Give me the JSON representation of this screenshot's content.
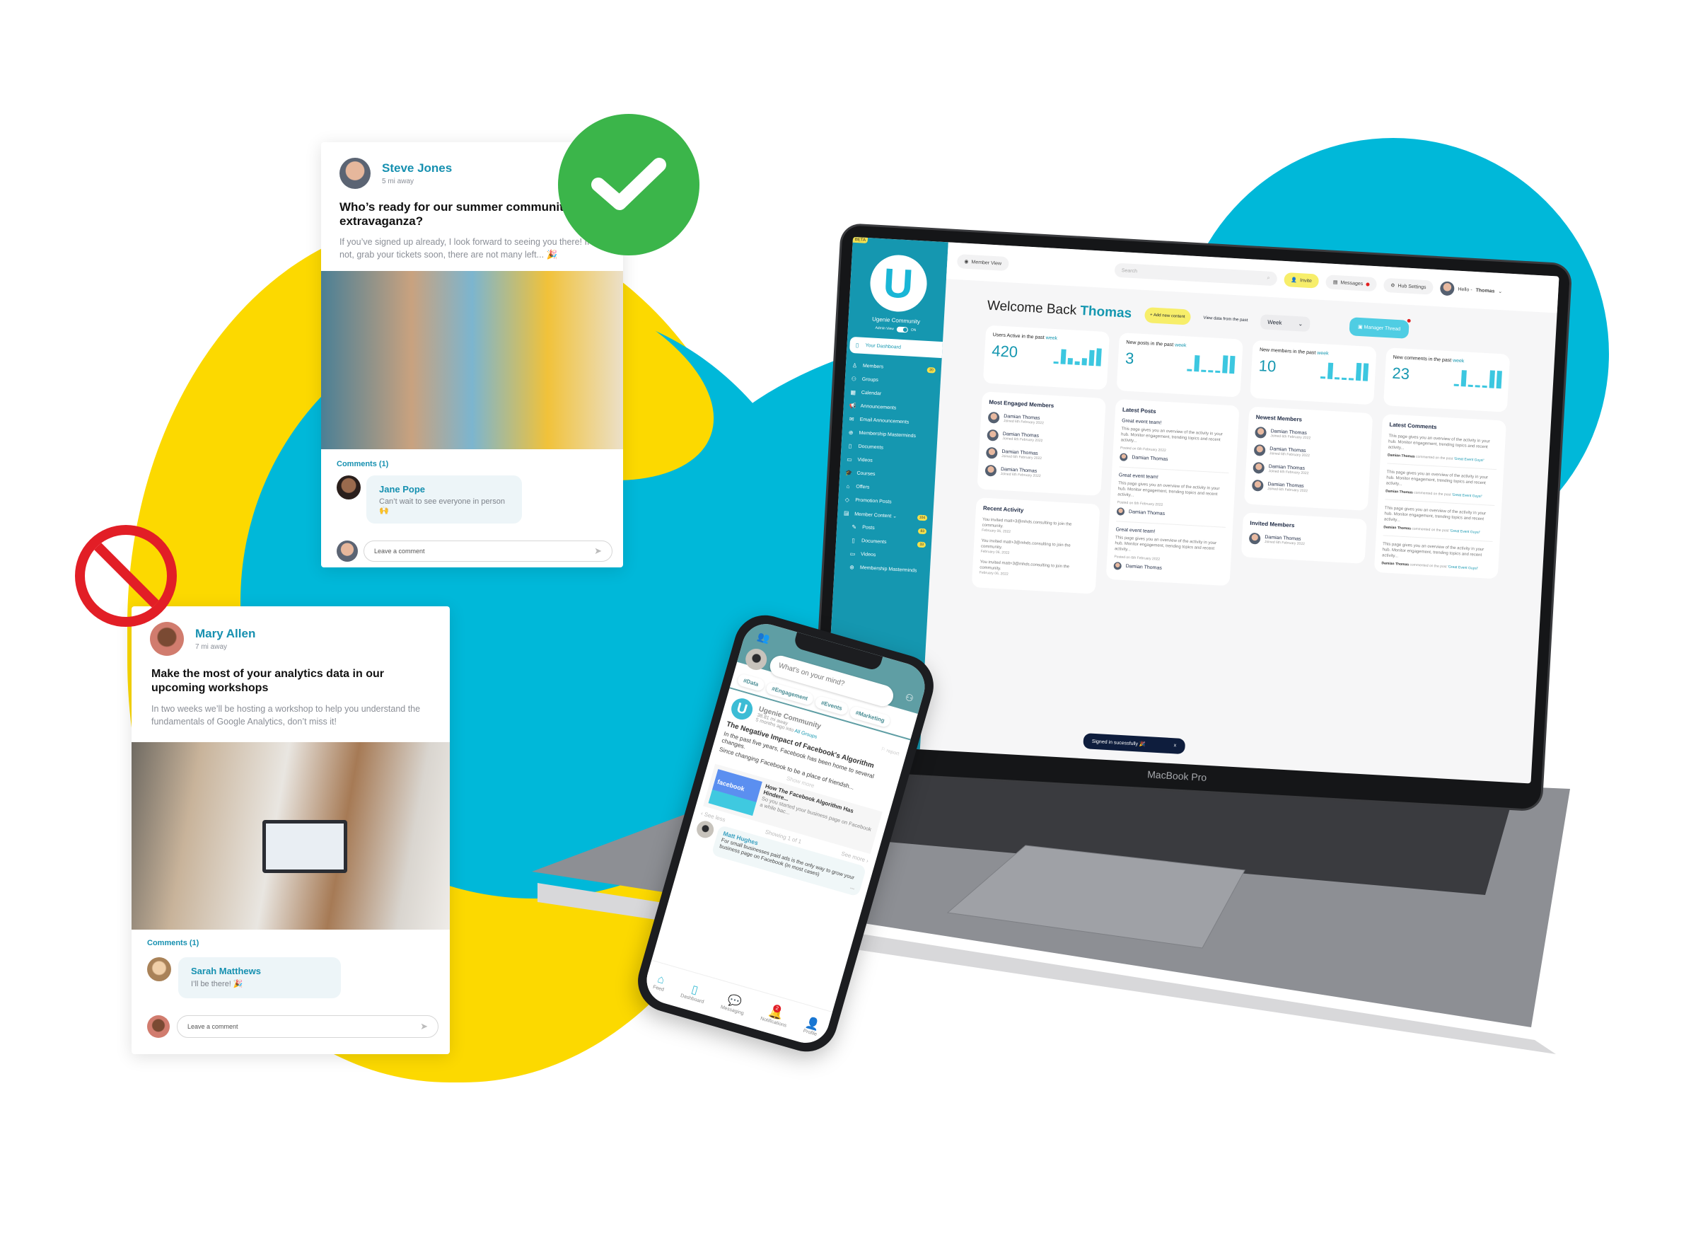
{
  "colors": {
    "yellow": "#fcd900",
    "cyan": "#00b8d9",
    "green": "#3bb54a",
    "red": "#e21e26",
    "teal": "#1597b0"
  },
  "approved_icon": "checkmark-icon",
  "rejected_icon": "prohibited-icon",
  "posts": [
    {
      "author": "Steve Jones",
      "distance": "5 mi away",
      "title": "Who’s ready for our summer community extravaganza?",
      "body": "If you’ve signed up already, I look forward to seeing you there! If not, grab your tickets soon, there are not many left... 🎉",
      "comments_label": "Comments (1)",
      "comment": {
        "author": "Jane Pope",
        "text": "Can’t wait to see everyone in person 🙌"
      },
      "comment_placeholder": "Leave a comment"
    },
    {
      "author": "Mary Allen",
      "distance": "7 mi away",
      "title": "Make the most of your analytics data in our upcoming workshops",
      "body": "In two weeks we’ll be hosting a workshop to help you understand the fundamentals of Google Analytics, don’t miss it!",
      "comments_label": "Comments (1)",
      "comment": {
        "author": "Sarah Matthews",
        "text": "I’ll be there! 🎉"
      },
      "comment_placeholder": "Leave a comment"
    }
  ],
  "laptop": {
    "label": "MacBook Pro"
  },
  "dashboard": {
    "beta": "BETA",
    "brand": "Ugenie Community",
    "admin_view": "Admin View",
    "toggle": "ON",
    "sidebar": [
      {
        "label": "Your Dashboard",
        "icon": "▯",
        "active": true
      },
      {
        "label": "Members",
        "icon": "♙",
        "badge": "20"
      },
      {
        "label": "Groups",
        "icon": "⚇"
      },
      {
        "label": "Calendar",
        "icon": "▦"
      },
      {
        "label": "Announcements",
        "icon": "📢"
      },
      {
        "label": "Email Announcements",
        "icon": "✉"
      },
      {
        "label": "Membership Masterminds",
        "icon": "⊕"
      },
      {
        "label": "Documents",
        "icon": "▯"
      },
      {
        "label": "Videos",
        "icon": "▭"
      },
      {
        "label": "Courses",
        "icon": "🎓"
      },
      {
        "label": "Offers",
        "icon": "⌂"
      },
      {
        "label": "Promotion Posts",
        "icon": "◇"
      },
      {
        "label": "Member Content ⌄",
        "icon": "▤",
        "badge": "104"
      },
      {
        "label": "Posts",
        "icon": "✎",
        "badge": "83",
        "sub": true
      },
      {
        "label": "Documents",
        "icon": "▯",
        "badge": "33",
        "sub": true
      },
      {
        "label": "Videos",
        "icon": "▭",
        "sub": true
      },
      {
        "label": "Membership Masterminds",
        "icon": "⊕",
        "sub": true
      }
    ],
    "topbar": {
      "member_view": "Member View",
      "search_placeholder": "Search",
      "invite": "Invite",
      "messages": "Messages",
      "hub_settings": "Hub Settings",
      "greeting": "Hello -",
      "user": "Thomas"
    },
    "welcome": "Welcome Back",
    "welcome_name": "Thomas",
    "add_content": "+ Add new content",
    "view_data": "View data from the past",
    "period": "Week",
    "manager_thread": "Manager Thread",
    "stats": [
      {
        "label": "Users Active in the past",
        "unit": "week",
        "value": "420",
        "spark": [
          0.1,
          0.8,
          0.35,
          0.2,
          0.4,
          0.85,
          0.95
        ]
      },
      {
        "label": "New posts in the past",
        "unit": "week",
        "value": "3",
        "spark": [
          0.1,
          0.9,
          0.1,
          0.1,
          0.1,
          0.95,
          0.95
        ]
      },
      {
        "label": "New members in the past",
        "unit": "week",
        "value": "10",
        "spark": [
          0.1,
          0.9,
          0.1,
          0.1,
          0.1,
          0.95,
          0.95
        ]
      },
      {
        "label": "New comments in the past",
        "unit": "week",
        "value": "23",
        "spark": [
          0.1,
          0.9,
          0.1,
          0.1,
          0.1,
          0.95,
          0.95
        ]
      }
    ],
    "most_engaged": {
      "title": "Most Engaged Members",
      "items": [
        {
          "name": "Damian Thomas",
          "sub": "Joined 6th February 2022"
        },
        {
          "name": "Damian Thomas",
          "sub": "Joined 6th February 2022"
        },
        {
          "name": "Damian Thomas",
          "sub": "Joined 6th February 2022"
        },
        {
          "name": "Damian Thomas",
          "sub": "Joined 6th February 2022"
        }
      ]
    },
    "recent_activity": {
      "title": "Recent Activity",
      "items": [
        {
          "text": "You invited matt+3@mhds.consulting to join the community.",
          "date": "February 06, 2022"
        },
        {
          "text": "You invited matt+3@mhds.consulting to join the community.",
          "date": "February 06, 2022"
        },
        {
          "text": "You invited matt+3@mhds.consulting to join the community.",
          "date": "February 06, 2022"
        }
      ]
    },
    "latest_posts": {
      "title": "Latest Posts",
      "items": [
        {
          "title": "Great event team!",
          "text": "This page gives you an overview of the activity in your hub. Monitor engagement, trending topics and recent activity...",
          "date": "Posted on 6th February 2022",
          "author": "Damian Thomas"
        },
        {
          "title": "Great event team!",
          "text": "This page gives you an overview of the activity in your hub. Monitor engagement, trending topics and recent activity...",
          "date": "Posted on 6th February 2022",
          "author": "Damian Thomas"
        },
        {
          "title": "Great event team!",
          "text": "This page gives you an overview of the activity in your hub. Monitor engagement, trending topics and recent activity...",
          "date": "Posted on 6th February 2022",
          "author": "Damian Thomas"
        }
      ]
    },
    "newest_members": {
      "title": "Newest Members",
      "items": [
        {
          "name": "Damian Thomas",
          "sub": "Joined 6th February 2022"
        },
        {
          "name": "Damian Thomas",
          "sub": "Joined 6th February 2022"
        },
        {
          "name": "Damian Thomas",
          "sub": "Joined 6th February 2022"
        },
        {
          "name": "Damian Thomas",
          "sub": "Joined 6th February 2022"
        }
      ]
    },
    "invited_members": {
      "title": "Invited Members",
      "items": [
        {
          "name": "Damian Thomas",
          "sub": "Joined 6th February 2022"
        }
      ]
    },
    "latest_comments": {
      "title": "Latest Comments",
      "items": [
        {
          "text": "This page gives you an overview of the activity in your hub. Monitor engagement, trending topics and recent activity...",
          "author": "Damian Thomas",
          "action": "commented on the post",
          "post": "'Great Event Guys!'"
        },
        {
          "text": "This page gives you an overview of the activity in your hub. Monitor engagement, trending topics and recent activity...",
          "author": "Damian Thomas",
          "action": "commented on the post",
          "post": "'Great Event Guys!'"
        },
        {
          "text": "This page gives you an overview of the activity in your hub. Monitor engagement, trending topics and recent activity...",
          "author": "Damian Thomas",
          "action": "commented on the post",
          "post": "'Great Event Guys!'"
        },
        {
          "text": "This page gives you an overview of the activity in your hub. Monitor engagement, trending topics and recent activity...",
          "author": "Damian Thomas",
          "action": "commented on the post",
          "post": "'Great Event Guys!'"
        }
      ]
    },
    "toast": "Signed in sucessfully 🎉",
    "toast_close": "x"
  },
  "phone": {
    "search_placeholder": "What's on your mind?",
    "tags": [
      "#Data",
      "#Engagement",
      "#Events",
      "#Marketing"
    ],
    "post": {
      "author": "Ugenie Community",
      "distance": "38.81 mi away",
      "time": "5 months ago into",
      "group": "All Groups",
      "report": "report",
      "title": "The Negative Impact of Facebook's Algorithm",
      "body1": "In the past five years, Facebook has been home to several changes.",
      "body2": "Since changing Facebook to be a place of friendsh...",
      "show_more": "Show more",
      "link": {
        "thumb": "facebook",
        "title": "How The Facebook Algorithm Has Hindere...",
        "desc": "So you started your business page on Facebook a while bac..."
      },
      "see_less": "‹ See less",
      "showing": "Showing 1 of 1",
      "see_more": "See more ›",
      "comment": {
        "author": "Matt Hughes",
        "text": "For small businesses paid ads is the only way to grow your business page on Facebook (in most cases)",
        "more": "•••"
      }
    },
    "nav": [
      {
        "label": "Feed",
        "icon": "⌂",
        "active": true
      },
      {
        "label": "Dashboard",
        "icon": "▯"
      },
      {
        "label": "Messaging",
        "icon": "💬"
      },
      {
        "label": "Notifications",
        "icon": "🔔",
        "badge": "2"
      },
      {
        "label": "Profile",
        "icon": "👤"
      }
    ]
  }
}
